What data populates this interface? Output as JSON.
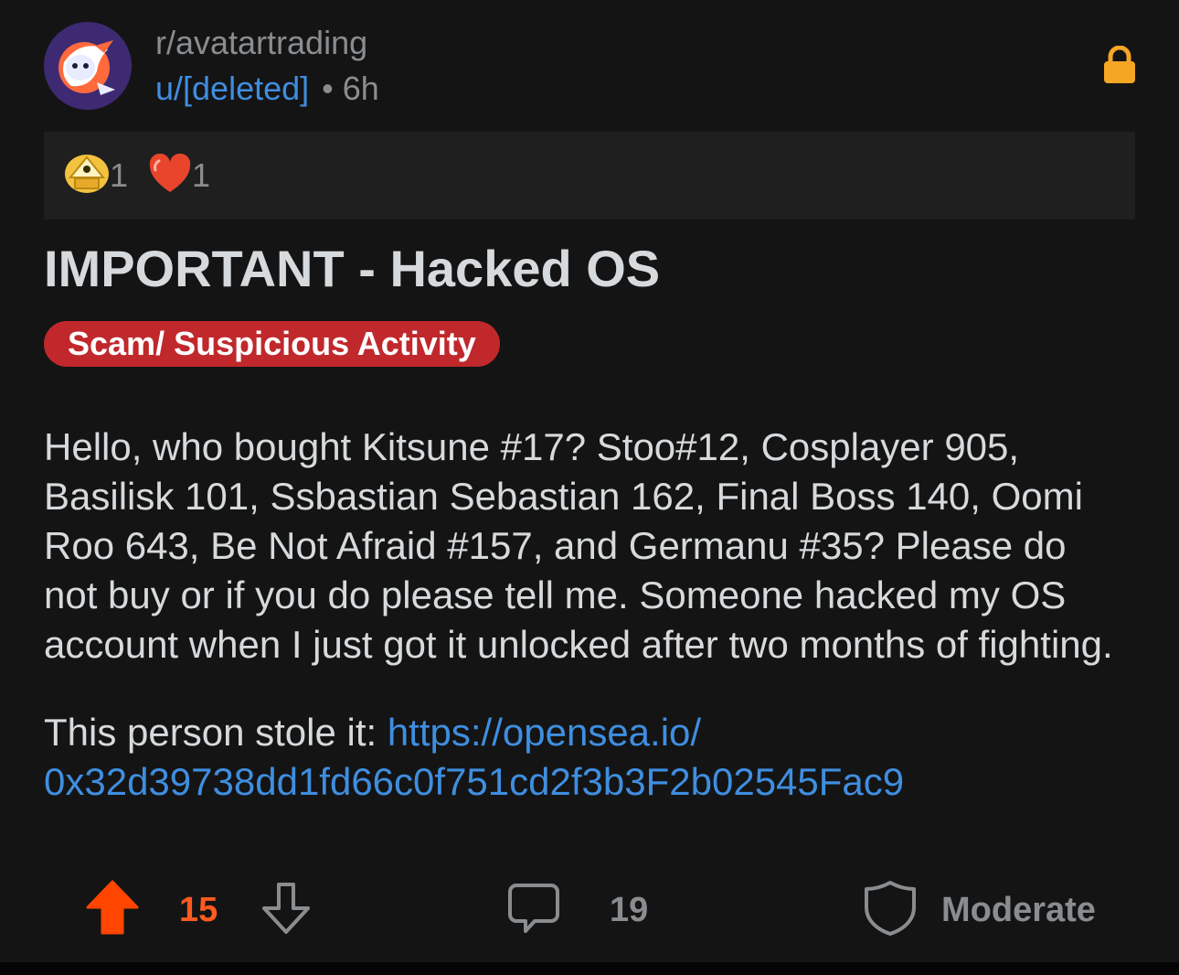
{
  "header": {
    "subreddit": "r/avatartrading",
    "author": "u/[deleted]",
    "separator": "•",
    "age": "6h",
    "avatar_icon": "subreddit-avatar-icon",
    "lock_icon": "lock-icon",
    "lock_color": "#f5a623"
  },
  "awards": [
    {
      "icon": "gold-temple-award-icon",
      "count": "1"
    },
    {
      "icon": "heart-award-icon",
      "count": "1"
    }
  ],
  "post": {
    "title": "IMPORTANT - Hacked OS",
    "flair": "Scam/ Suspicious Activity",
    "flair_color": "#c0282c",
    "body_paragraph_1": "Hello, who bought Kitsune #17? Stoo#12, Cosplayer 905, Basilisk 101, Ssbastian Sebastian 162, Final Boss 140, Oomi Roo 643, Be Not Afraid #157, and Germanu #35? Please do not buy or if you do please tell me. Someone hacked my OS account when I just got it unlocked after two months of fighting.",
    "body_paragraph_2_prefix": "This person stole it: ",
    "link_line_1": "https://opensea.io/",
    "link_line_2": "0x32d39738dd1fd66c0f751cd2f3b3F2b02545Fac9",
    "link_color": "#3f8ee0"
  },
  "actions": {
    "score": "15",
    "score_color": "#ff5a1f",
    "comments": "19",
    "moderate": "Moderate"
  }
}
